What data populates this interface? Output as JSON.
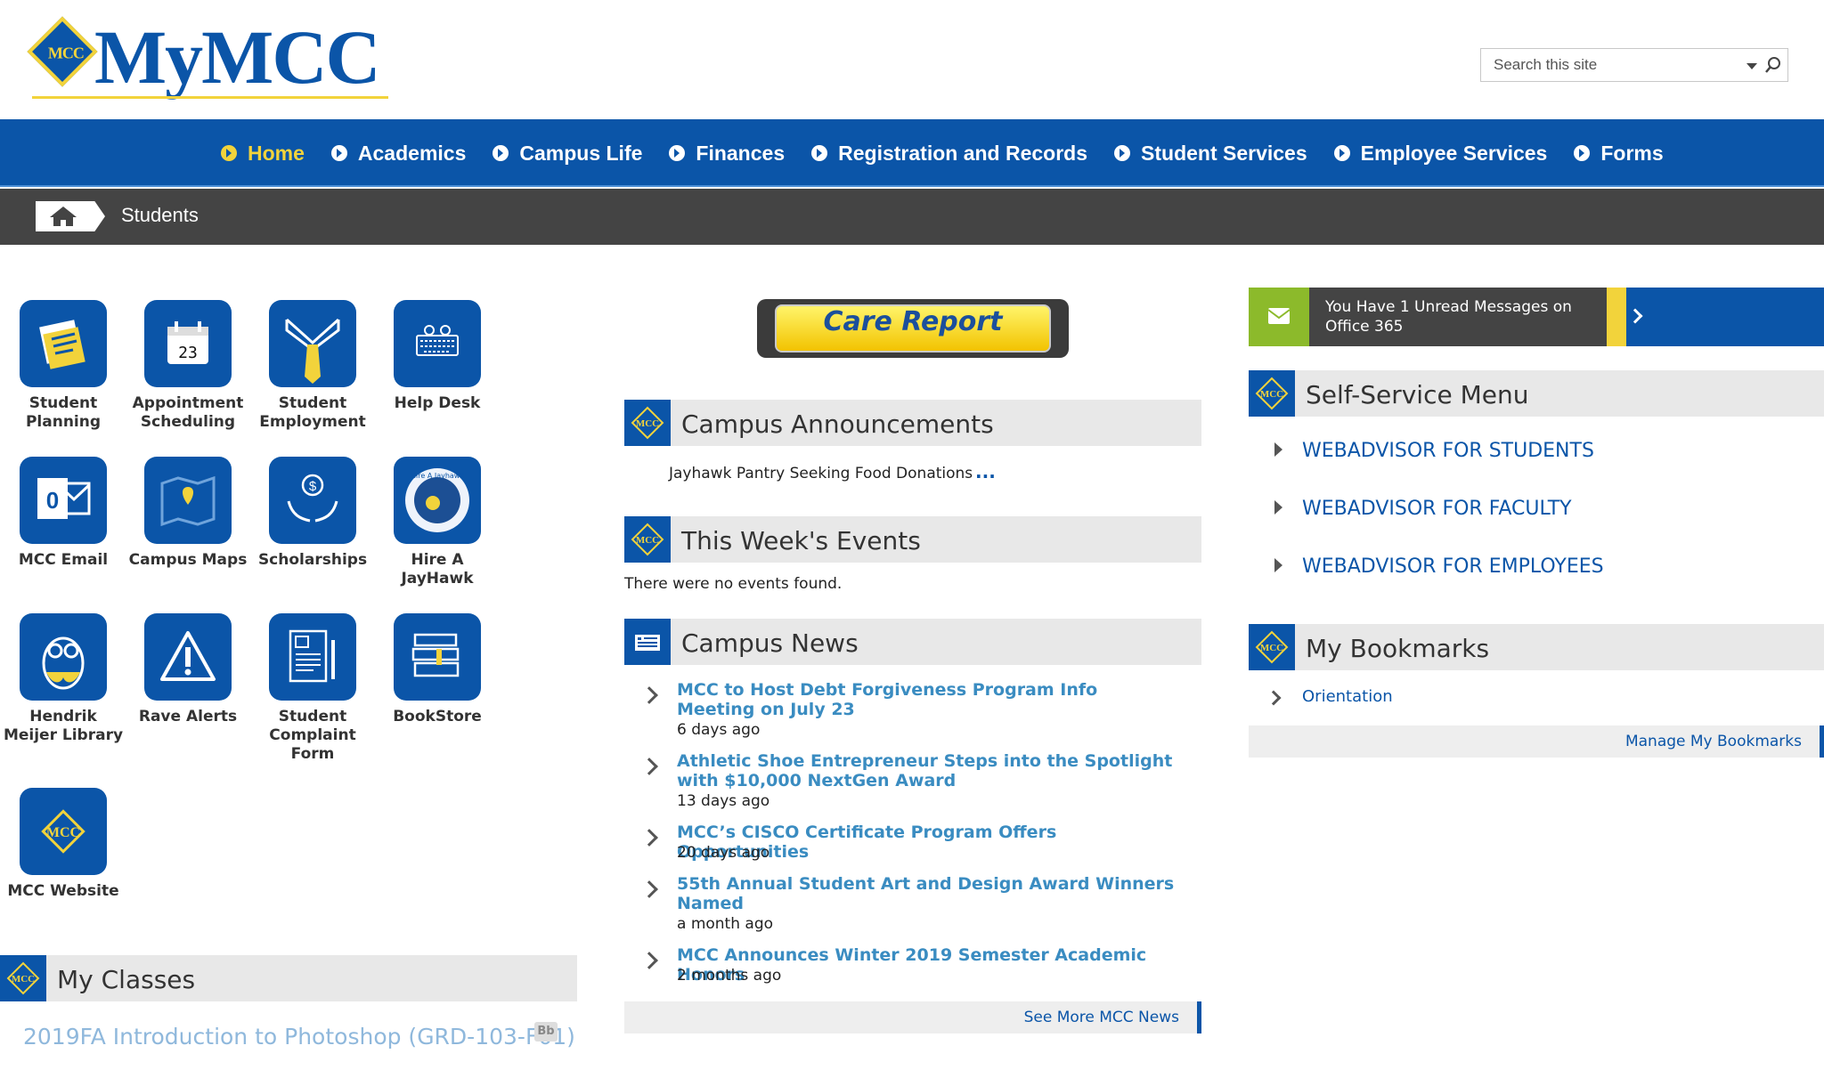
{
  "header": {
    "logo_text": "MyMCC",
    "logo_badge": "MCC",
    "search": {
      "placeholder": "Search this site"
    }
  },
  "nav": {
    "items": [
      {
        "label": "Home",
        "active": true
      },
      {
        "label": "Academics"
      },
      {
        "label": "Campus Life"
      },
      {
        "label": "Finances"
      },
      {
        "label": "Registration and Records"
      },
      {
        "label": "Student Services"
      },
      {
        "label": "Employee Services"
      },
      {
        "label": "Forms"
      }
    ]
  },
  "breadcrumb": {
    "title": "Students"
  },
  "tiles": [
    {
      "label": "Student Planning",
      "icon": "planner-icon"
    },
    {
      "label": "Appointment Scheduling",
      "icon": "calendar-icon"
    },
    {
      "label": "Student Employment",
      "icon": "tie-icon"
    },
    {
      "label": "Help Desk",
      "icon": "keyboard-icon"
    },
    {
      "label": "MCC Email",
      "icon": "outlook-icon"
    },
    {
      "label": "Campus Maps",
      "icon": "map-icon"
    },
    {
      "label": "Scholarships",
      "icon": "money-hands-icon"
    },
    {
      "label": "Hire A JayHawk",
      "icon": "jayhawk-badge-icon",
      "badge_text": "Hire A Jayhawk"
    },
    {
      "label": "Hendrik Meijer Library",
      "icon": "owl-icon"
    },
    {
      "label": "Rave Alerts",
      "icon": "alert-icon"
    },
    {
      "label": "Student Complaint Form",
      "icon": "form-icon"
    },
    {
      "label": "BookStore",
      "icon": "books-icon"
    },
    {
      "label": "MCC Website",
      "icon": "mcc-logo-icon"
    }
  ],
  "care_report": {
    "label": "Care Report"
  },
  "announcements": {
    "title": "Campus Announcements",
    "items": [
      {
        "text": "Jayhawk Pantry Seeking Food Donations",
        "more": "..."
      }
    ]
  },
  "events": {
    "title": "This Week's Events",
    "empty": "There were no events found."
  },
  "news": {
    "title": "Campus News",
    "items": [
      {
        "title": "MCC to Host Debt Forgiveness Program Info Meeting on July 23",
        "age": "6 days ago"
      },
      {
        "title": "Athletic Shoe Entrepreneur Steps into the Spotlight with $10,000 NextGen Award",
        "age": "13 days ago"
      },
      {
        "title": "MCC’s CISCO Certificate Program Offers Opportunities",
        "age": "20 days ago"
      },
      {
        "title": "55th Annual Student Art and Design Award Winners Named",
        "age": "a month ago"
      },
      {
        "title": "MCC Announces Winter 2019 Semester Academic Honors",
        "age": "2 months ago"
      }
    ],
    "see_more": "See More MCC News"
  },
  "my_classes": {
    "title": "My Classes",
    "items": [
      {
        "text": "2019FA Introduction to Photoshop (GRD-103-F01)",
        "badge": "Bb"
      }
    ]
  },
  "office365": {
    "text": "You Have 1 Unread Messages on Office 365"
  },
  "self_service": {
    "title": "Self-Service Menu",
    "items": [
      "WEBADVISOR FOR STUDENTS",
      "WEBADVISOR FOR FACULTY",
      "WEBADVISOR FOR EMPLOYEES"
    ]
  },
  "bookmarks": {
    "title": "My Bookmarks",
    "items": [
      "Orientation"
    ],
    "manage": "Manage My Bookmarks"
  },
  "colors": {
    "brand_blue": "#0b55a8",
    "brand_yellow": "#f2d33b",
    "link_blue": "#3a8cc1",
    "office_green": "#8cba2b",
    "crumb_gray": "#444444"
  }
}
